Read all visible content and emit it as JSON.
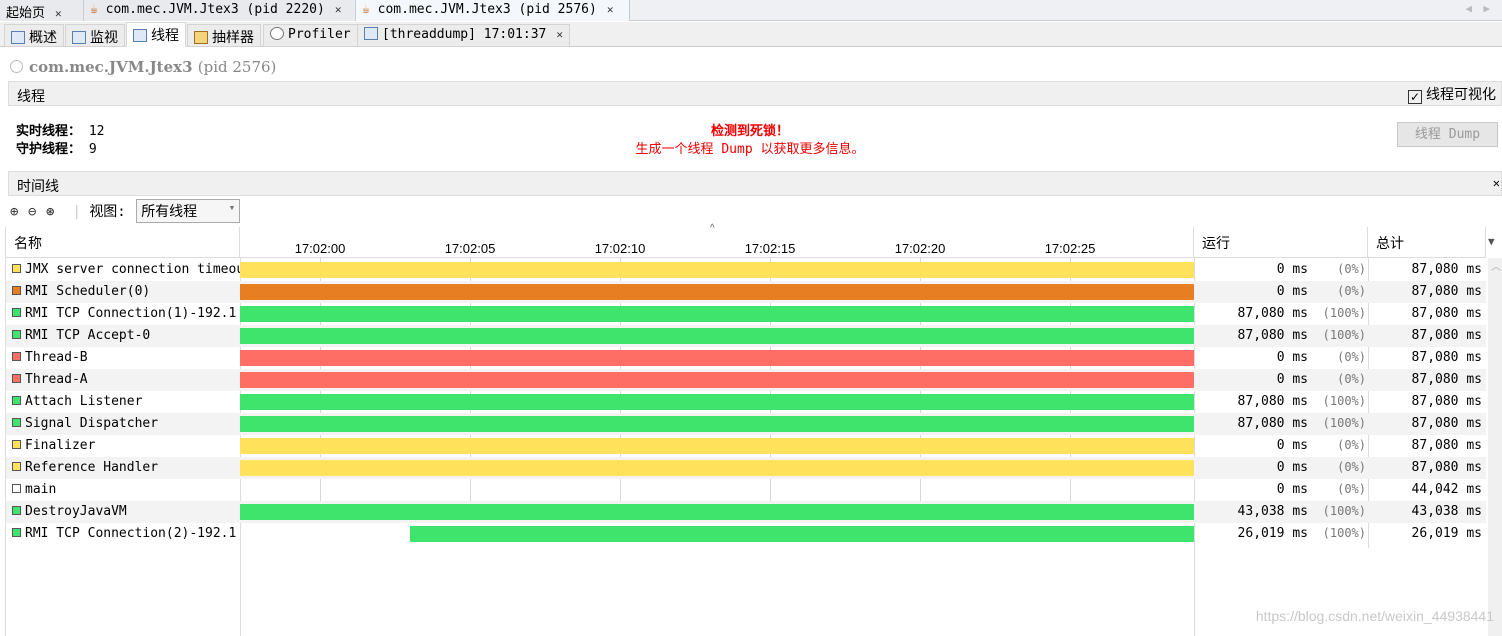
{
  "doc_tabs": [
    {
      "label": "起始页"
    },
    {
      "label": "com.mec.JVM.Jtex3 (pid 2220)"
    },
    {
      "label": "com.mec.JVM.Jtex3 (pid 2576)"
    }
  ],
  "sub_tabs": [
    {
      "label": "概述"
    },
    {
      "label": "监视"
    },
    {
      "label": "线程"
    },
    {
      "label": "抽样器"
    },
    {
      "label": "Profiler"
    },
    {
      "label": "[threaddump] 17:01:37"
    }
  ],
  "app_title": {
    "name": "com.mec.JVM.Jtex3",
    "pid": "(pid 2576)"
  },
  "threads_section": {
    "title": "线程",
    "visualize_label": "线程可视化",
    "visualize_checked": true
  },
  "stats": {
    "live_label": "实时线程：",
    "live": "12",
    "daemon_label": "守护线程：",
    "daemon": "9"
  },
  "deadlock": {
    "title": "检测到死锁！",
    "message": "生成一个线程 Dump 以获取更多信息。"
  },
  "dump_button": "线程 Dump",
  "timeline": {
    "title": "时间线",
    "view_label": "视图:",
    "view_value": "所有线程",
    "ticks": [
      "17:02:00",
      "17:02:05",
      "17:02:10",
      "17:02:15",
      "17:02:20",
      "17:02:25"
    ]
  },
  "columns": {
    "name": "名称",
    "running": "运行",
    "total": "总计"
  },
  "state_colors": {
    "running": "#3ee46c",
    "sleeping": "#ffe15c",
    "wait": "#e87e22",
    "monitor": "#ff6e64",
    "none": "#ffffff"
  },
  "rows": [
    {
      "name": "JMX server connection timeout",
      "state": "sleeping",
      "running": "0 ms",
      "pct": "(0%)",
      "total": "87,080 ms"
    },
    {
      "name": "RMI Scheduler(0)",
      "state": "wait",
      "running": "0 ms",
      "pct": "(0%)",
      "total": "87,080 ms"
    },
    {
      "name": "RMI TCP Connection(1)-192.1",
      "state": "running",
      "running": "87,080 ms",
      "pct": "(100%)",
      "total": "87,080 ms"
    },
    {
      "name": "RMI TCP Accept-0",
      "state": "running",
      "running": "87,080 ms",
      "pct": "(100%)",
      "total": "87,080 ms"
    },
    {
      "name": "Thread-B",
      "state": "monitor",
      "running": "0 ms",
      "pct": "(0%)",
      "total": "87,080 ms"
    },
    {
      "name": "Thread-A",
      "state": "monitor",
      "running": "0 ms",
      "pct": "(0%)",
      "total": "87,080 ms"
    },
    {
      "name": "Attach Listener",
      "state": "running",
      "running": "87,080 ms",
      "pct": "(100%)",
      "total": "87,080 ms"
    },
    {
      "name": "Signal Dispatcher",
      "state": "running",
      "running": "87,080 ms",
      "pct": "(100%)",
      "total": "87,080 ms"
    },
    {
      "name": "Finalizer",
      "state": "sleeping",
      "running": "0 ms",
      "pct": "(0%)",
      "total": "87,080 ms"
    },
    {
      "name": "Reference Handler",
      "state": "sleeping",
      "running": "0 ms",
      "pct": "(0%)",
      "total": "87,080 ms"
    },
    {
      "name": "main",
      "state": "none",
      "running": "0 ms",
      "pct": "(0%)",
      "total": "44,042 ms"
    },
    {
      "name": "DestroyJavaVM",
      "state": "running",
      "running": "43,038 ms",
      "pct": "(100%)",
      "total": "43,038 ms"
    },
    {
      "name": "RMI TCP Connection(2)-192.1",
      "state": "running",
      "running": "26,019 ms",
      "pct": "(100%)",
      "total": "26,019 ms",
      "bar_start": "17:02:03"
    }
  ],
  "watermark": "https://blog.csdn.net/weixin_44938441"
}
